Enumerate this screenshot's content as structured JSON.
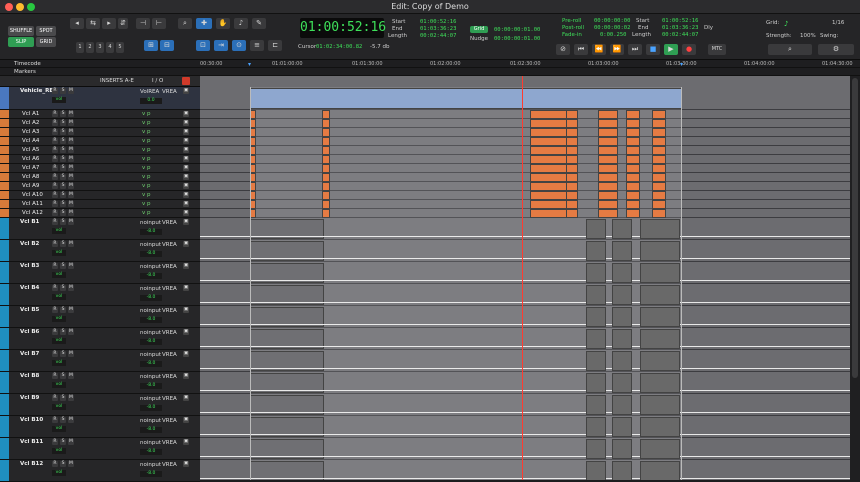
{
  "window": {
    "title": "Edit: Copy of Demo"
  },
  "modes": {
    "shuffle": "SHUFFLE",
    "spot": "SPOT",
    "slip": "SLIP",
    "grid": "GRID"
  },
  "zoom_presets": [
    "1",
    "2",
    "3",
    "4",
    "5"
  ],
  "counter": {
    "main": "01:00:52:16",
    "cursor_label": "Cursor",
    "cursor": "01:02:34:00.82",
    "level": "-5.7 db"
  },
  "selection": {
    "start_label": "Start",
    "end_label": "End",
    "length_label": "Length",
    "start": "01:00:52:16",
    "end": "01:03:36:23",
    "length": "00:02:44:07"
  },
  "nudge": {
    "grid_label": "Grid",
    "nudge_label": "Nudge",
    "grid": "00:00:00:01.00",
    "nudge": "00:00:00:01.00"
  },
  "prepost": {
    "preroll_label": "Pre-roll",
    "postroll_label": "Post-roll",
    "fadein_label": "Fade-in",
    "preroll": "00:00:00:00",
    "postroll": "00:00:00:02",
    "fadein": "0:00.250",
    "start": "01:00:52:16",
    "end": "01:03:36:23",
    "length": "00:02:44:07",
    "dly_label": "Dly"
  },
  "transport": {
    "mtc": "MTC"
  },
  "grid_panel": {
    "grid_label": "Grid:",
    "grid_value": "1/16",
    "strength_label": "Strength:",
    "strength": "100%",
    "swing_label": "Swing:"
  },
  "rulers": {
    "timecode": "Timecode",
    "markers": "Markers",
    "ticks": [
      "00:30:00",
      "01:01:00:00",
      "01:01:30:00",
      "01:02:00:00",
      "01:02:30:00",
      "01:03:00:00",
      "01:03:30:00",
      "01:04:00:00",
      "01:04:30:00"
    ]
  },
  "columns": {
    "inserts": "INSERTS A-E",
    "io": "I / O"
  },
  "tracks": [
    {
      "name": "Vehicle_REA",
      "vol": "0.0",
      "type": "master",
      "out": "VolREA"
    },
    {
      "name": "Vcl A1",
      "type": "a"
    },
    {
      "name": "Vcl A2",
      "type": "a"
    },
    {
      "name": "Vcl A3",
      "type": "a"
    },
    {
      "name": "Vcl A4",
      "type": "a"
    },
    {
      "name": "Vcl A5",
      "type": "a"
    },
    {
      "name": "Vcl A6",
      "type": "a"
    },
    {
      "name": "Vcl A7",
      "type": "a"
    },
    {
      "name": "Vcl A8",
      "type": "a"
    },
    {
      "name": "Vcl A9",
      "type": "a"
    },
    {
      "name": "Vcl A10",
      "type": "a"
    },
    {
      "name": "Vcl A11",
      "type": "a"
    },
    {
      "name": "Vcl A12",
      "type": "a"
    },
    {
      "name": "Vcl B1",
      "type": "b",
      "vol": "-8.0"
    },
    {
      "name": "Vcl B2",
      "type": "b",
      "vol": "-8.0"
    },
    {
      "name": "Vcl B3",
      "type": "b",
      "vol": "-8.0"
    },
    {
      "name": "Vcl B4",
      "type": "b",
      "vol": "-8.0"
    },
    {
      "name": "Vcl B5",
      "type": "b",
      "vol": "-8.0"
    },
    {
      "name": "Vcl B6",
      "type": "b",
      "vol": "-8.0"
    },
    {
      "name": "Vcl B7",
      "type": "b",
      "vol": "-8.0"
    },
    {
      "name": "Vcl B8",
      "type": "b",
      "vol": "-8.0"
    },
    {
      "name": "Vcl B9",
      "type": "b",
      "vol": "-8.0"
    },
    {
      "name": "Vcl B10",
      "type": "b",
      "vol": "-8.0"
    },
    {
      "name": "Vcl B11",
      "type": "b",
      "vol": "-8.0"
    },
    {
      "name": "Vcl B12",
      "type": "b",
      "vol": "-8.0"
    }
  ],
  "b_labels": {
    "input": "noinput",
    "output": "VREA",
    "vol_label": "vol"
  },
  "colors": {
    "accent": "#2b6fb8",
    "counter": "#3ee05a",
    "clip_orange": "#e2692a",
    "master": "#4a78c0",
    "group": "#1f8fc0"
  }
}
